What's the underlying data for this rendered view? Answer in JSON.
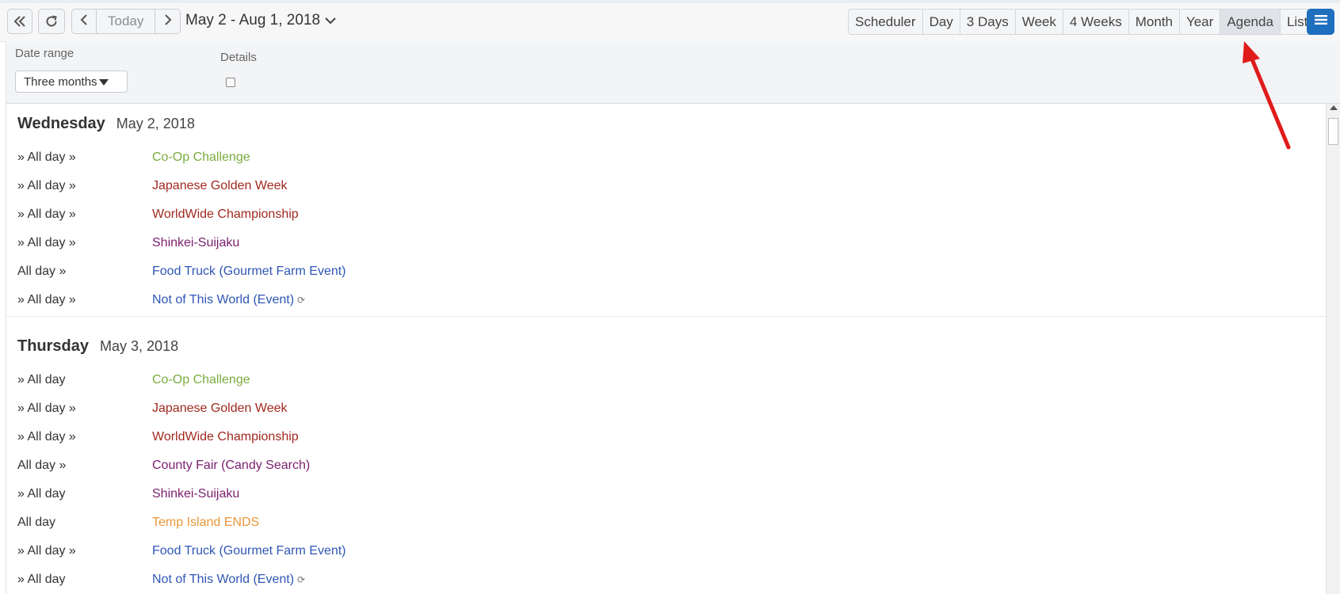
{
  "toolbar": {
    "today_label": "Today",
    "range_title": "May 2 - Aug 1, 2018",
    "views": [
      {
        "label": "Scheduler",
        "active": false
      },
      {
        "label": "Day",
        "active": false
      },
      {
        "label": "3 Days",
        "active": false
      },
      {
        "label": "Week",
        "active": false
      },
      {
        "label": "4 Weeks",
        "active": false
      },
      {
        "label": "Month",
        "active": false
      },
      {
        "label": "Year",
        "active": false
      },
      {
        "label": "Agenda",
        "active": true
      },
      {
        "label": "List",
        "active": false
      }
    ],
    "accent": "#1f6fbf"
  },
  "filters": {
    "date_range_label": "Date range",
    "date_range_value": "Three months",
    "details_label": "Details",
    "details_checked": false
  },
  "days": [
    {
      "weekday": "Wednesday",
      "date": "May 2, 2018",
      "events": [
        {
          "time": "» All day »",
          "title": "Co-Op Challenge",
          "color": "#7aab3e",
          "recurring": false
        },
        {
          "time": "» All day »",
          "title": "Japanese Golden Week",
          "color": "#a12a1f",
          "recurring": false
        },
        {
          "time": "» All day »",
          "title": "WorldWide Championship",
          "color": "#a12a1f",
          "recurring": false
        },
        {
          "time": "» All day »",
          "title": "Shinkei-Suijaku",
          "color": "#7a1f6e",
          "recurring": false
        },
        {
          "time": "All day »",
          "title": "Food Truck (Gourmet Farm Event)",
          "color": "#2f57b5",
          "recurring": false
        },
        {
          "time": "» All day »",
          "title": "Not of This World (Event)",
          "color": "#2f57b5",
          "recurring": true
        }
      ]
    },
    {
      "weekday": "Thursday",
      "date": "May 3, 2018",
      "events": [
        {
          "time": "» All day",
          "title": "Co-Op Challenge",
          "color": "#7aab3e",
          "recurring": false
        },
        {
          "time": "» All day »",
          "title": "Japanese Golden Week",
          "color": "#a12a1f",
          "recurring": false
        },
        {
          "time": "» All day »",
          "title": "WorldWide Championship",
          "color": "#a12a1f",
          "recurring": false
        },
        {
          "time": "All day »",
          "title": "County Fair (Candy Search)",
          "color": "#7a1f6e",
          "recurring": false
        },
        {
          "time": "» All day",
          "title": "Shinkei-Suijaku",
          "color": "#7a1f6e",
          "recurring": false
        },
        {
          "time": "All day",
          "title": "Temp Island ENDS",
          "color": "#e8973a",
          "recurring": false
        },
        {
          "time": "» All day »",
          "title": "Food Truck (Gourmet Farm Event)",
          "color": "#2f57b5",
          "recurring": false
        },
        {
          "time": "» All day",
          "title": "Not of This World (Event)",
          "color": "#2f57b5",
          "recurring": true
        }
      ]
    }
  ]
}
